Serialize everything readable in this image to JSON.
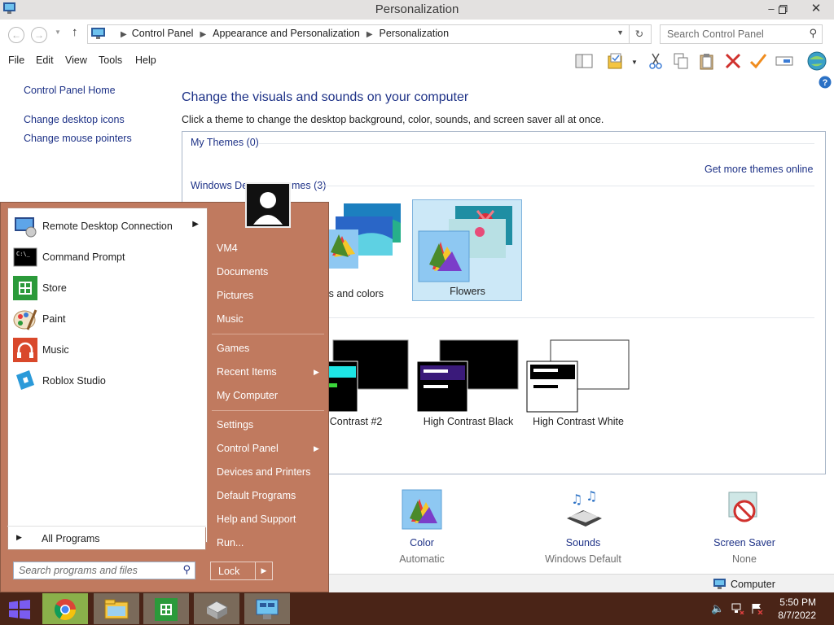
{
  "window": {
    "title": "Personalization"
  },
  "address": {
    "crumbs": [
      "Control Panel",
      "Appearance and Personalization",
      "Personalization"
    ],
    "search_placeholder": "Search Control Panel"
  },
  "menu": [
    "File",
    "Edit",
    "View",
    "Tools",
    "Help"
  ],
  "left_panel": {
    "home": "Control Panel Home",
    "links": [
      "Change desktop icons",
      "Change mouse pointers"
    ]
  },
  "main": {
    "heading": "Change the visuals and sounds on your computer",
    "subheading": "Click a theme to change the desktop background, color, sounds, and screen saver all at once.",
    "my_themes": "My Themes (0)",
    "get_more": "Get more themes online",
    "windows_default_partial_left": "Windows De",
    "windows_default_partial_right": "mes (3)",
    "themes": [
      {
        "label": "ines and colors"
      },
      {
        "label": "Flowers"
      }
    ],
    "hc_themes": [
      {
        "label": "igh Contrast #2"
      },
      {
        "label": "High Contrast Black"
      },
      {
        "label": "High Contrast White"
      }
    ],
    "bottom": [
      {
        "label": "Color",
        "sub": "Automatic"
      },
      {
        "label": "Sounds",
        "sub": "Windows Default"
      },
      {
        "label": "Screen Saver",
        "sub": "None"
      }
    ]
  },
  "status": {
    "computer": "Computer"
  },
  "start_menu": {
    "programs": [
      {
        "label": "Remote Desktop Connection",
        "has_arrow": true
      },
      {
        "label": "Command Prompt"
      },
      {
        "label": "Store"
      },
      {
        "label": "Paint"
      },
      {
        "label": "Music"
      },
      {
        "label": "Roblox Studio"
      }
    ],
    "all_programs": "All Programs",
    "search_placeholder": "Search programs and files",
    "right_items": [
      "VM4",
      "Documents",
      "Pictures",
      "Music",
      "Games",
      "Recent Items",
      "My Computer",
      "Settings",
      "Control Panel",
      "Devices and Printers",
      "Default Programs",
      "Help and Support",
      "Run..."
    ],
    "lock": "Lock"
  },
  "taskbar": {
    "time": "5:50 PM",
    "date": "8/7/2022"
  },
  "colors": {
    "start_menu": "#c07a5f",
    "taskbar": "#4a2417",
    "link": "#1e3287",
    "selection": "#cce8f7"
  }
}
